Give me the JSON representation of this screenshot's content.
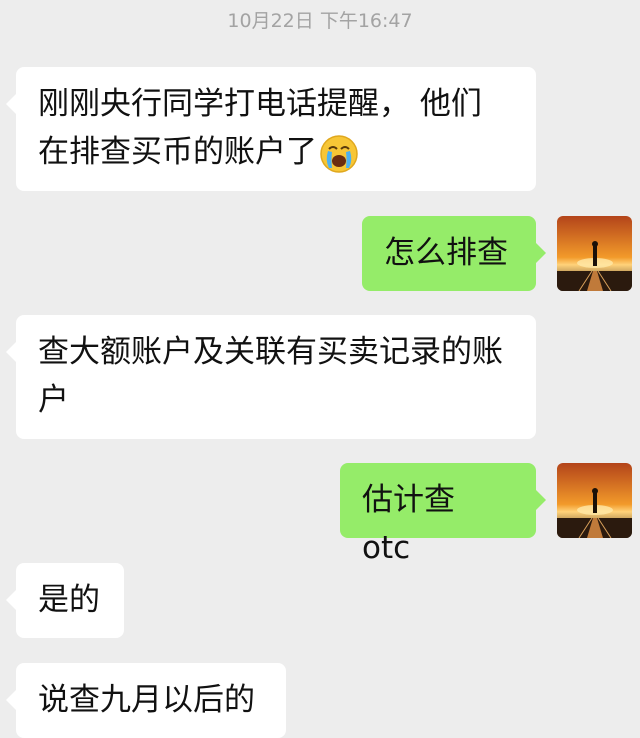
{
  "timestamp": "10月22日 下午16:47",
  "messages": [
    {
      "side": "in",
      "text": "刚刚央行同学打电话提醒， 他们在排查买币的账户了",
      "emoji": "loudly-crying-face-icon"
    },
    {
      "side": "out",
      "text": "怎么排查"
    },
    {
      "side": "in",
      "text": "查大额账户及关联有买卖记录的账户"
    },
    {
      "side": "out",
      "text": "估计查 otc"
    },
    {
      "side": "in",
      "text": "是的"
    },
    {
      "side": "in",
      "text": "说查九月以后的"
    }
  ],
  "colors": {
    "background": "#ededed",
    "incoming_bubble": "#ffffff",
    "outgoing_bubble": "#95ec69",
    "timestamp": "#a3a3a3"
  }
}
